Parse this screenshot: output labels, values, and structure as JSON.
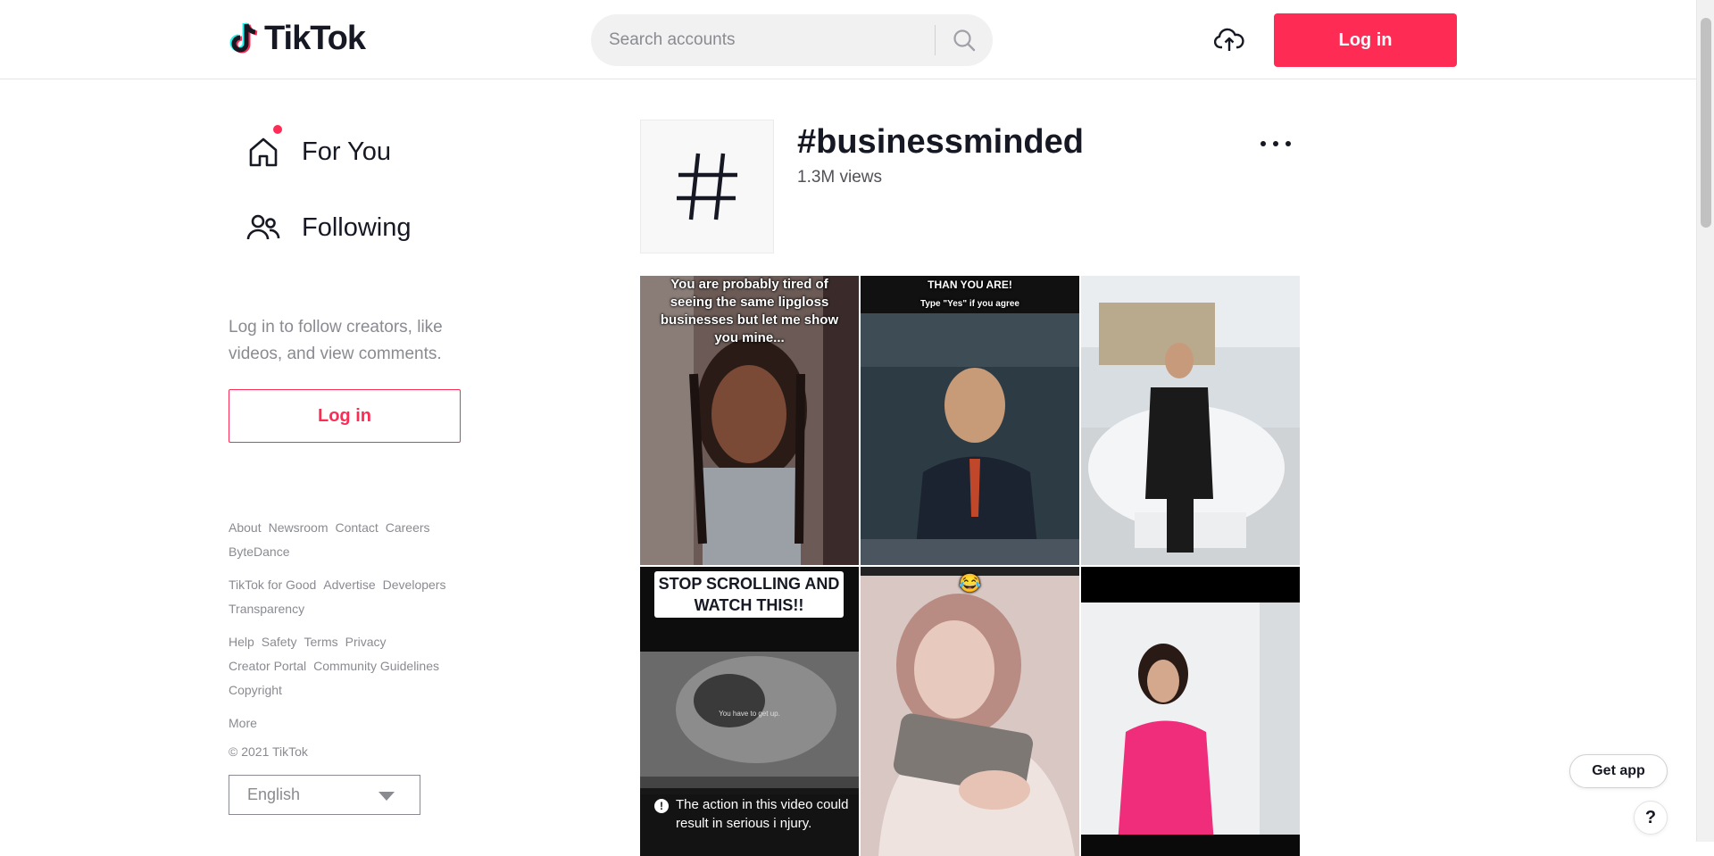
{
  "header": {
    "logo_text": "TikTok",
    "search_placeholder": "Search accounts",
    "login_label": "Log in"
  },
  "sidebar": {
    "nav": [
      {
        "label": "For You",
        "icon": "home-icon"
      },
      {
        "label": "Following",
        "icon": "users-icon"
      }
    ],
    "login_prompt": "Log in to follow creators, like videos, and view comments.",
    "login_label": "Log in",
    "footer_groups": [
      [
        "About",
        "Newsroom",
        "Contact",
        "Careers",
        "ByteDance"
      ],
      [
        "TikTok for Good",
        "Advertise",
        "Developers",
        "Transparency"
      ],
      [
        "Help",
        "Safety",
        "Terms",
        "Privacy",
        "Creator Portal",
        "Community Guidelines",
        "Copyright"
      ],
      [
        "More"
      ]
    ],
    "copyright": "© 2021 TikTok",
    "language": "English"
  },
  "tag": {
    "title": "#businessminded",
    "views": "1.3M views"
  },
  "videos": [
    {
      "caption": "You are probably tired of seeing the same lipgloss businesses but let me show you mine..."
    },
    {
      "caption": "THAN YOU ARE!",
      "subcaption": "Type \"Yes\" if you agree"
    },
    {
      "caption": ""
    },
    {
      "caption": "STOP SCROLLING AND WATCH THIS!!",
      "subcaption": "You have to get up.",
      "warning": "The action in this video could result in serious i njury."
    },
    {
      "caption": "😂"
    },
    {
      "caption": ""
    }
  ],
  "floating": {
    "get_app": "Get app",
    "help": "?"
  },
  "colors": {
    "accent": "#fe2c55",
    "text": "#161823",
    "muted": "#8a8b91"
  }
}
